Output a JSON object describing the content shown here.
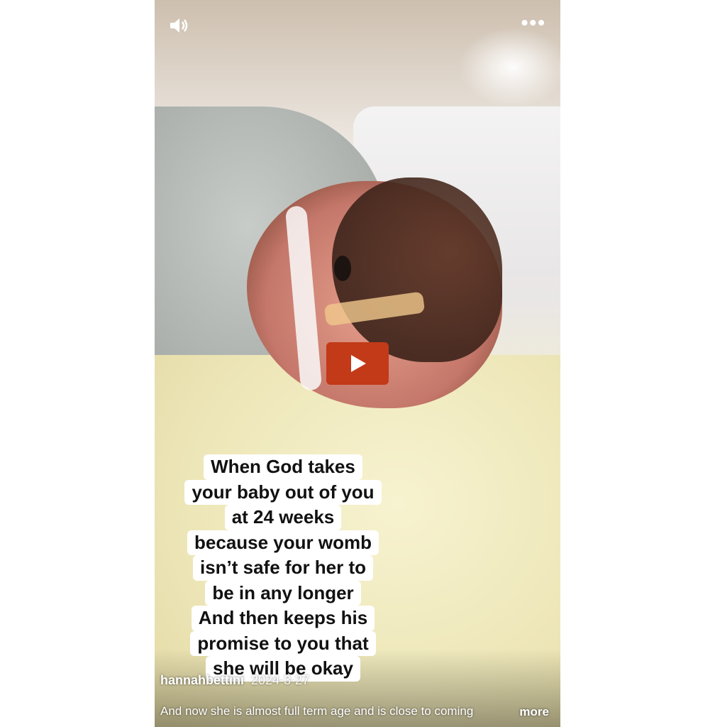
{
  "caption_lines": [
    "When God takes",
    "your baby out of you",
    "at 24 weeks",
    "because your womb",
    "isn’t safe for her to",
    "be in any longer",
    "And then keeps his",
    "promise to you that",
    "she will be okay"
  ],
  "author": "hannahbettini",
  "date": "2024-3-27",
  "description": "And now she is almost full term age and is close to coming",
  "more_label": "more",
  "icons": {
    "volume": "speaker-icon",
    "menu": "more-options-icon",
    "play": "play-icon"
  },
  "colors": {
    "play_button": "#c23a18",
    "caption_bg": "#ffffff"
  }
}
